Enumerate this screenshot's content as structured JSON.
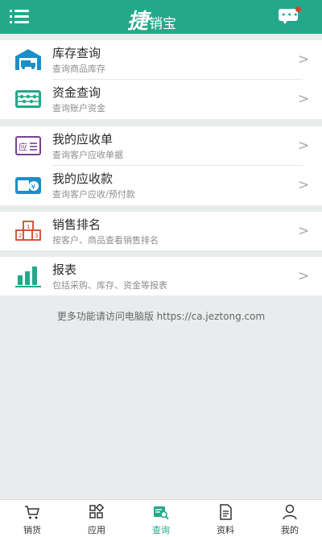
{
  "header": {
    "logo_big": "捷",
    "logo_small": "销宝",
    "menu_icon": "hamburger-menu-icon",
    "message_icon": "chat-bubble-icon",
    "colors": {
      "primary": "#23a98a",
      "badge": "#e53935"
    }
  },
  "groups": [
    {
      "items": [
        {
          "title": "库存查询",
          "subtitle": "查询商品库存",
          "icon": "warehouse-icon"
        },
        {
          "title": "资金查询",
          "subtitle": "查询账户资金",
          "icon": "abacus-icon"
        }
      ]
    },
    {
      "items": [
        {
          "title": "我的应收单",
          "subtitle": "查询客户应收单据",
          "icon": "receivable-document-icon"
        },
        {
          "title": "我的应收款",
          "subtitle": "查询客户应收/预付款",
          "icon": "wallet-yuan-icon"
        }
      ]
    },
    {
      "items": [
        {
          "title": "销售排名",
          "subtitle": "按客户、商品查看销售排名",
          "icon": "ranking-podium-icon"
        }
      ]
    },
    {
      "items": [
        {
          "title": "报表",
          "subtitle": "包括采购、库存、资金等报表",
          "icon": "bar-chart-icon"
        }
      ]
    }
  ],
  "chevron": ">",
  "note": "更多功能请访问电脑版 https://ca.jeztong.com",
  "tabbar": [
    {
      "label": "销货",
      "icon": "cart-icon",
      "active": false
    },
    {
      "label": "应用",
      "icon": "apps-grid-icon",
      "active": false
    },
    {
      "label": "查询",
      "icon": "query-search-icon",
      "active": true
    },
    {
      "label": "资料",
      "icon": "document-icon",
      "active": false
    },
    {
      "label": "我的",
      "icon": "user-icon",
      "active": false
    }
  ]
}
